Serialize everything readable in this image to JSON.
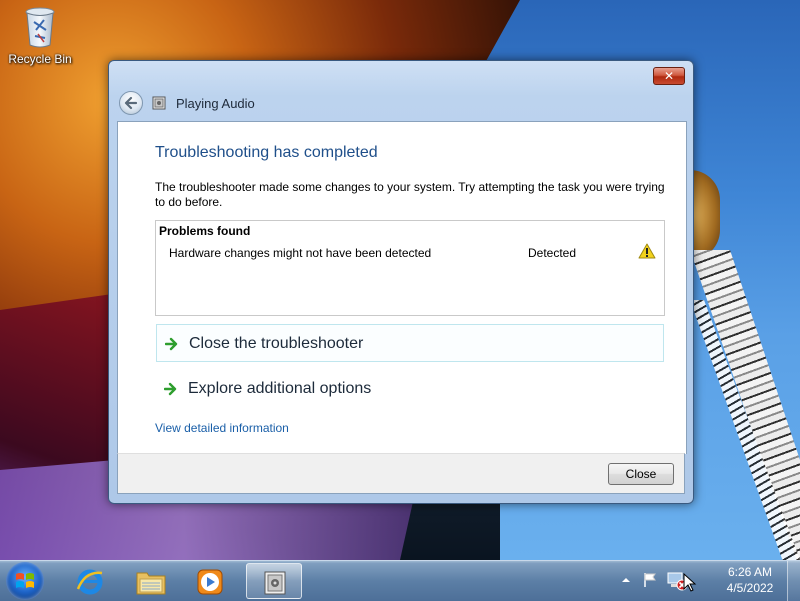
{
  "desktop": {
    "icons": [
      {
        "label": "Recycle Bin",
        "icon": "recycle-bin-icon"
      }
    ]
  },
  "window": {
    "title": "Playing Audio",
    "close_glyph": "✕",
    "heading": "Troubleshooting has completed",
    "description": "The troubleshooter made some changes to your system. Try attempting the task you were trying to do before.",
    "problems": {
      "header": "Problems found",
      "rows": [
        {
          "text": "Hardware changes might not have been detected",
          "status": "Detected",
          "icon": "warning-icon"
        }
      ]
    },
    "commands": [
      {
        "label": "Close the troubleshooter",
        "icon": "green-arrow-icon",
        "selected": true
      },
      {
        "label": "Explore additional options",
        "icon": "green-arrow-icon",
        "selected": false
      }
    ],
    "detail_link": "View detailed information",
    "close_button": "Close"
  },
  "taskbar": {
    "pinned": [
      {
        "name": "internet-explorer",
        "icon": "ie-icon"
      },
      {
        "name": "windows-explorer",
        "icon": "folder-icon"
      },
      {
        "name": "media-player",
        "icon": "media-player-icon"
      },
      {
        "name": "troubleshooter",
        "icon": "troubleshooter-icon",
        "active": true
      }
    ],
    "tray_icons": [
      "show-hidden-icons-arrow",
      "action-center-flag-icon",
      "network-error-icon",
      "mouse-cursor"
    ],
    "clock": {
      "time": "6:26 AM",
      "date": "4/5/2022"
    }
  },
  "colors": {
    "heading": "#1f4f8a",
    "link": "#1a5fa8",
    "close_button_red": "#c84a30",
    "arrow_green": "#2e9e2e",
    "warning_yellow": "#f2d21c"
  }
}
